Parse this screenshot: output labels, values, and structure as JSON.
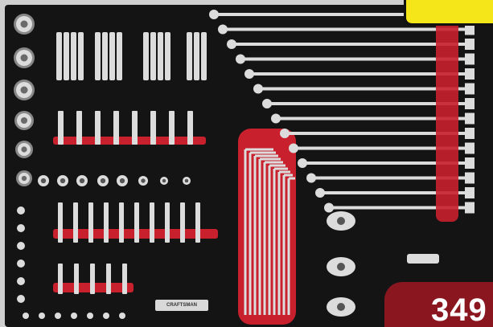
{
  "scene": {
    "subject": "socket-and-wrench-tool-set-foam-tray",
    "tray_color": "#141414",
    "foam_accent_color": "#c8202c",
    "tool_color": "#dcdcdc"
  },
  "badges": {
    "yellow_badge_color": "#f5e61a",
    "price_badge_color": "#8a1620",
    "price_text": "349"
  },
  "brand_plate_text": "CRAFTSMAN"
}
